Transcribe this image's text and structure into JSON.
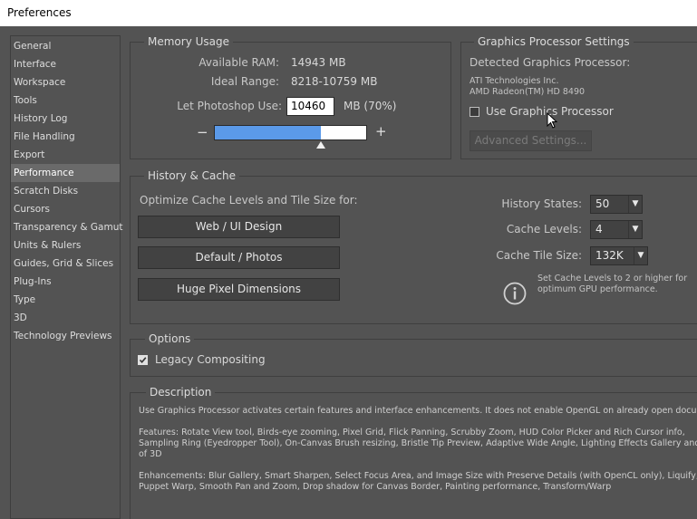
{
  "window": {
    "title": "Preferences"
  },
  "sidebar": {
    "items": [
      {
        "label": "General",
        "active": false
      },
      {
        "label": "Interface",
        "active": false
      },
      {
        "label": "Workspace",
        "active": false
      },
      {
        "label": "Tools",
        "active": false
      },
      {
        "label": "History Log",
        "active": false
      },
      {
        "label": "File Handling",
        "active": false
      },
      {
        "label": "Export",
        "active": false
      },
      {
        "label": "Performance",
        "active": true
      },
      {
        "label": "Scratch Disks",
        "active": false
      },
      {
        "label": "Cursors",
        "active": false
      },
      {
        "label": "Transparency & Gamut",
        "active": false
      },
      {
        "label": "Units & Rulers",
        "active": false
      },
      {
        "label": "Guides, Grid & Slices",
        "active": false
      },
      {
        "label": "Plug-Ins",
        "active": false
      },
      {
        "label": "Type",
        "active": false
      },
      {
        "label": "3D",
        "active": false
      },
      {
        "label": "Technology Previews",
        "active": false
      }
    ]
  },
  "memory": {
    "title": "Memory Usage",
    "available_label": "Available RAM:",
    "available_value": "14943 MB",
    "ideal_label": "Ideal Range:",
    "ideal_value": "8218-10759 MB",
    "let_label": "Let Photoshop Use:",
    "let_value": "10460",
    "let_suffix": "MB (70%)",
    "minus": "−",
    "plus": "+",
    "slider_percent": 70,
    "slider_color": "#5b9ae9"
  },
  "gpu": {
    "title": "Graphics Processor Settings",
    "detected_label": "Detected Graphics Processor:",
    "vendor": "ATI Technologies Inc.",
    "model": "AMD Radeon(TM) HD 8490",
    "use_label": "Use Graphics Processor",
    "use_checked": false,
    "advanced_button": "Advanced Settings..."
  },
  "history_cache": {
    "title": "History & Cache",
    "optimize_label": "Optimize Cache Levels and Tile Size for:",
    "buttons": [
      "Web / UI Design",
      "Default / Photos",
      "Huge Pixel Dimensions"
    ],
    "history_states_label": "History States:",
    "history_states_value": "50",
    "cache_levels_label": "Cache Levels:",
    "cache_levels_value": "4",
    "cache_tile_label": "Cache Tile Size:",
    "cache_tile_value": "132K",
    "info_icon": "info-icon",
    "info_text_1": "Set Cache Levels to 2 or higher for",
    "info_text_2": "optimum GPU performance."
  },
  "options": {
    "title": "Options",
    "legacy_label": "Legacy Compositing",
    "legacy_checked": true
  },
  "description": {
    "title": "Description",
    "line1": "Use Graphics Processor activates certain features and interface enhancements. It does not enable OpenGL on already open documents.",
    "features_1": "Features: Rotate View tool, Birds-eye zooming, Pixel Grid, Flick Panning, Scrubby Zoom, HUD Color Picker and Rich Cursor info,",
    "features_2": "Sampling Ring (Eyedropper Tool), On-Canvas Brush resizing, Bristle Tip Preview, Adaptive Wide Angle, Lighting Effects Gallery and all",
    "features_3": "of 3D",
    "enh_1": "Enhancements: Blur Gallery, Smart Sharpen, Select Focus Area, and Image Size with Preserve Details (with OpenCL only), Liquify,",
    "enh_2": "Puppet Warp, Smooth Pan and Zoom, Drop shadow for Canvas Border, Painting performance, Transform/Warp"
  }
}
